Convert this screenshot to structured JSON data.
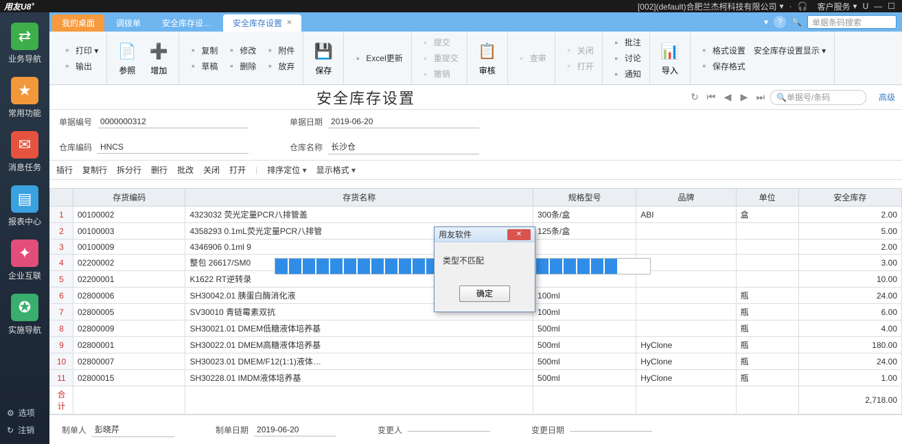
{
  "titlebar": {
    "brand": "用友U8",
    "brand_sup": "+",
    "company": "[002](default)合肥兰杰柯科技有限公司",
    "service": "客户服务",
    "u_icon": "U"
  },
  "sidebar": {
    "items": [
      {
        "label": "业务导航",
        "bg": "#3eae4a",
        "glyph": "⇄"
      },
      {
        "label": "常用功能",
        "bg": "#f2973a",
        "glyph": "★"
      },
      {
        "label": "消息任务",
        "bg": "#e5533f",
        "glyph": "✉"
      },
      {
        "label": "报表中心",
        "bg": "#3aa1e0",
        "glyph": "▤"
      },
      {
        "label": "企业互联",
        "bg": "#e24d7a",
        "glyph": "✦"
      },
      {
        "label": "实施导航",
        "bg": "#3aae6c",
        "glyph": "✪"
      }
    ],
    "bottom": [
      {
        "label": "选项",
        "glyph": "⚙"
      },
      {
        "label": "注销",
        "glyph": "↻"
      }
    ]
  },
  "tabs": {
    "items": [
      {
        "label": "我的桌面",
        "active": false,
        "home": true
      },
      {
        "label": "调拨单",
        "active": false
      },
      {
        "label": "安全库存设…",
        "active": false
      },
      {
        "label": "安全库存设置",
        "active": true,
        "closable": true
      }
    ],
    "search_placeholder": "单据条码搜索",
    "menu_glyph": "▾",
    "help_glyph": "?",
    "search_glyph": "🔍"
  },
  "toolbar": {
    "col1": [
      "打印",
      "输出"
    ],
    "big1": [
      {
        "label": "参照",
        "glyph": "📄",
        "color": "#3fa34a"
      },
      {
        "label": "增加",
        "glyph": "➕",
        "color": "#3fa34a"
      }
    ],
    "col2": [
      "复制",
      "修改",
      "附件"
    ],
    "col2b": [
      "草稿",
      "删除",
      "放弃"
    ],
    "big2": {
      "label": "保存",
      "glyph": "💾",
      "color": "#2a6fd6"
    },
    "col3": [
      "Excel更新"
    ],
    "col4": [
      "提交",
      "重提交",
      "撤销"
    ],
    "big3": {
      "label": "审核",
      "glyph": "📋",
      "color": "#a8a8a8"
    },
    "col5": [
      "查审"
    ],
    "col6": [
      "关闭",
      "打开"
    ],
    "col7": [
      "批注",
      "讨论",
      "通知"
    ],
    "big4": {
      "label": "导入",
      "glyph": "📊",
      "color": "#e79a3a"
    },
    "col8": [
      "格式设置",
      "安全库存设置显示"
    ],
    "col8b": [
      "保存格式"
    ]
  },
  "doc": {
    "title": "安全库存设置",
    "nav_search_placeholder": "单据号/条码",
    "advanced": "高级",
    "fields": {
      "bill_no_label": "单据编号",
      "bill_no": "0000000312",
      "bill_date_label": "单据日期",
      "bill_date": "2019-06-20",
      "wh_code_label": "仓库编码",
      "wh_code": "HNCS",
      "wh_name_label": "仓库名称",
      "wh_name": "长沙仓"
    },
    "actions": [
      "插行",
      "复制行",
      "拆分行",
      "删行",
      "批改",
      "关闭",
      "打开"
    ],
    "actions_dd": [
      "排序定位",
      "显示格式"
    ],
    "columns": [
      "存货编码",
      "存货名称",
      "规格型号",
      "品牌",
      "单位",
      "安全库存"
    ],
    "rows": [
      {
        "n": 1,
        "code": "00100002",
        "name": "4323032 荧光定量PCR八排管盖",
        "spec": "300条/盒",
        "brand": "ABI",
        "unit": "盒",
        "stock": "2.00"
      },
      {
        "n": 2,
        "code": "00100003",
        "name": "4358293 0.1mL荧光定量PCR八排管",
        "spec": "125条/盒",
        "brand": "",
        "unit": "",
        "stock": "5.00"
      },
      {
        "n": 3,
        "code": "00100009",
        "name": "4346906 0.1ml 9",
        "spec": "",
        "brand": "",
        "unit": "",
        "stock": "2.00"
      },
      {
        "n": 4,
        "code": "02200002",
        "name": "整包 26617/SM0",
        "spec": "",
        "brand": "",
        "unit": "",
        "stock": "3.00"
      },
      {
        "n": 5,
        "code": "02200001",
        "name": "K1622 RT逆转录",
        "spec": "",
        "brand": "",
        "unit": "",
        "stock": "10.00"
      },
      {
        "n": 6,
        "code": "02800006",
        "name": "SH30042.01 胰蛋白酶消化液",
        "spec": "100ml",
        "brand": "",
        "unit": "瓶",
        "stock": "24.00"
      },
      {
        "n": 7,
        "code": "02800005",
        "name": "SV30010 青链霉素双抗",
        "spec": "100ml",
        "brand": "",
        "unit": "瓶",
        "stock": "6.00"
      },
      {
        "n": 8,
        "code": "02800009",
        "name": "SH30021.01 DMEM低糖液体培养基",
        "spec": "500ml",
        "brand": "",
        "unit": "瓶",
        "stock": "4.00"
      },
      {
        "n": 9,
        "code": "02800001",
        "name": "SH30022.01 DMEM高糖液体培养基",
        "spec": "500ml",
        "brand": "HyClone",
        "unit": "瓶",
        "stock": "180.00"
      },
      {
        "n": 10,
        "code": "02800007",
        "name": "SH30023.01 DMEM/F12(1:1)液体…",
        "spec": "500ml",
        "brand": "HyClone",
        "unit": "瓶",
        "stock": "24.00"
      },
      {
        "n": 11,
        "code": "02800015",
        "name": "SH30228.01 IMDM液体培养基",
        "spec": "500ml",
        "brand": "HyClone",
        "unit": "瓶",
        "stock": "1.00"
      }
    ],
    "sum_label": "合计",
    "sum_value": "2,718.00",
    "footer": {
      "maker_label": "制单人",
      "maker": "彭晓芹",
      "mdate_label": "制单日期",
      "mdate": "2019-06-20",
      "changer_label": "变更人",
      "changer": "",
      "cdate_label": "变更日期",
      "cdate": ""
    }
  },
  "modal": {
    "title": "用友软件",
    "msg": "类型不匹配",
    "ok": "确定"
  },
  "progress": {
    "blocks": 25
  }
}
